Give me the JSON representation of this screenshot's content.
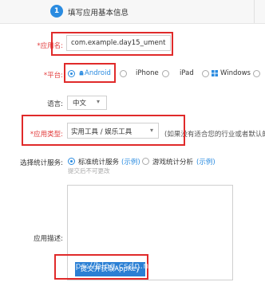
{
  "header": {
    "step_number": "1",
    "step_title": "填写应用基本信息"
  },
  "form": {
    "app_name": {
      "label": "*应用名:",
      "value": "com.example.day15_ument"
    },
    "platform": {
      "label": "*平台:",
      "options": [
        "Android",
        "iPhone",
        "iPad",
        "Windows"
      ],
      "selected": "Android"
    },
    "language": {
      "label": "语言:",
      "value": "中文",
      "arrow": "▾"
    },
    "category": {
      "label": "*应用类型:",
      "value": "实用工具 / 娱乐工具",
      "arrow": "▾",
      "hint": "(如果没有适合您的行业或者默认的"
    },
    "stats_service": {
      "label": "选择统计服务:",
      "options": [
        {
          "text": "标准统计服务",
          "link": "(示例)"
        },
        {
          "text": "游戏统计分析",
          "link": "(示例)"
        }
      ],
      "selected": "标准统计服务",
      "note": "提交后不可更改"
    },
    "description": {
      "label": "应用描述:"
    },
    "submit": {
      "label": "提交并获取AppKey"
    }
  },
  "watermark": "https://blog.csdn.net/qq_34178710",
  "colors": {
    "accent": "#2a8be0",
    "highlight": "#e02a2a",
    "required": "#e23b3b"
  }
}
